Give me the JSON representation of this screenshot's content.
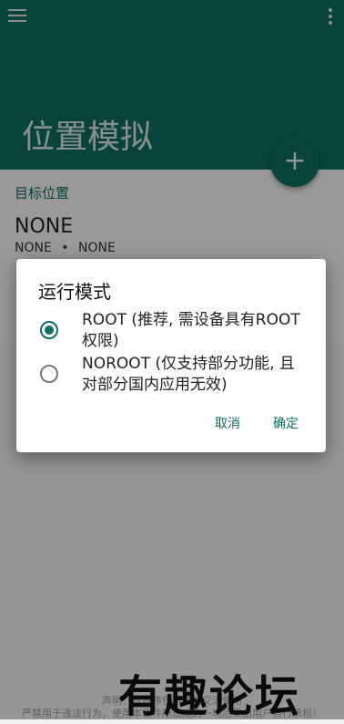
{
  "appbar": {
    "title": "位置模拟"
  },
  "content": {
    "target_label": "目标位置",
    "location_name": "NONE",
    "coords_lat": "NONE",
    "coords_sep": "•",
    "coords_lng": "NONE"
  },
  "dialog": {
    "title": "运行模式",
    "options": [
      {
        "label": "ROOT (推荐, 需设备具有ROOT权限)",
        "selected": true
      },
      {
        "label": "NOROOT (仅支持部分功能, 且对部分国内应用无效)",
        "selected": false
      }
    ],
    "cancel_label": "取消",
    "confirm_label": "确定"
  },
  "footer": {
    "line1": "声明：本程序仅供学习交流使用",
    "line2": "严禁用于违法行为，使用本软件所造成的一切后果由用户自行承担！"
  },
  "watermark": "有趣论坛",
  "colors": {
    "primary": "#0d6f62",
    "scrim": "rgba(0,0,0,0.38)"
  },
  "icons": {
    "menu": "hamburger-icon",
    "overflow": "more-vert-icon",
    "fab": "plus-icon"
  }
}
